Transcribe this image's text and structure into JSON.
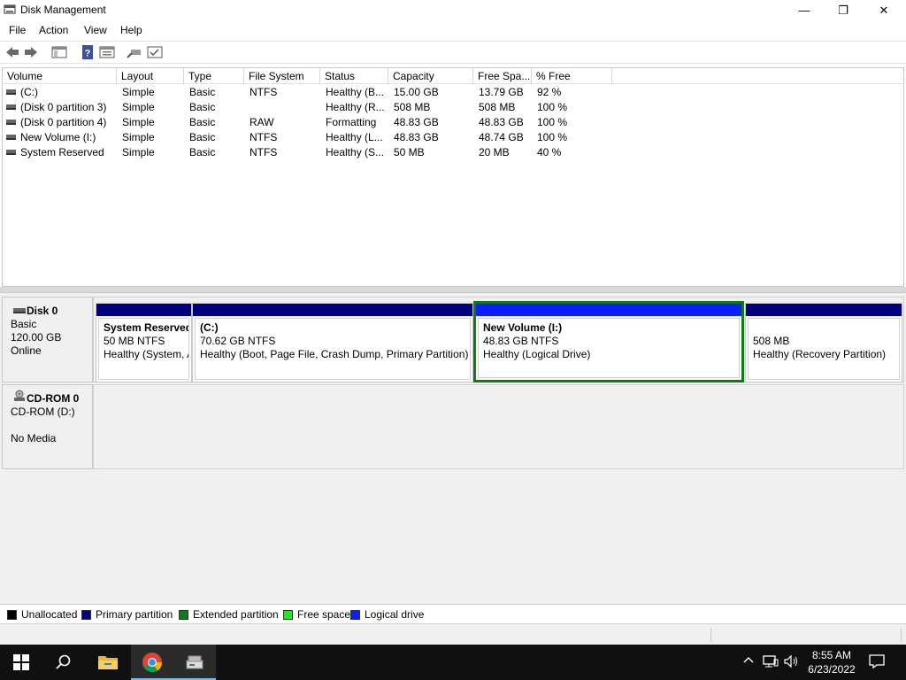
{
  "window": {
    "title": "Disk Management",
    "icon": "disk-management-icon",
    "controls": {
      "minimize": "—",
      "restore": "❐",
      "close": "✕"
    }
  },
  "menu": [
    "File",
    "Action",
    "View",
    "Help"
  ],
  "toolbar": [
    "back-arrow-icon",
    "forward-arrow-icon",
    "show-hide-console-tree-icon",
    "help-icon",
    "properties-icon",
    "connect-icon",
    "export-list-icon"
  ],
  "volume_list": {
    "columns": [
      "Volume",
      "Layout",
      "Type",
      "File System",
      "Status",
      "Capacity",
      "Free Spa...",
      "% Free"
    ],
    "rows": [
      [
        "(C:)",
        "Simple",
        "Basic",
        "NTFS",
        "Healthy (B...",
        "15.00 GB",
        "13.79 GB",
        "92 %"
      ],
      [
        "(Disk 0 partition 3)",
        "Simple",
        "Basic",
        "",
        "Healthy (R...",
        "508 MB",
        "508 MB",
        "100 %"
      ],
      [
        "(Disk 0 partition 4)",
        "Simple",
        "Basic",
        "RAW",
        "Formatting",
        "48.83 GB",
        "48.83 GB",
        "100 %"
      ],
      [
        "New Volume (I:)",
        "Simple",
        "Basic",
        "NTFS",
        "Healthy (L...",
        "48.83 GB",
        "48.74 GB",
        "100 %"
      ],
      [
        "System Reserved",
        "Simple",
        "Basic",
        "NTFS",
        "Healthy (S...",
        "50 MB",
        "20 MB",
        "40 %"
      ]
    ]
  },
  "disks": [
    {
      "name": "Disk 0",
      "lines": [
        "Basic",
        "120.00 GB",
        "Online"
      ],
      "partitions": [
        {
          "name": "System Reserved",
          "size": "50 MB NTFS",
          "status": "Healthy (System, A"
        },
        {
          "name": "(C:)",
          "size": "70.62 GB NTFS",
          "status": "Healthy (Boot, Page File, Crash Dump, Primary Partition)"
        },
        {
          "name": "New Volume  (I:)",
          "size": "48.83 GB NTFS",
          "status": "Healthy (Logical Drive)"
        },
        {
          "name": "",
          "size": "508 MB",
          "status": "Healthy (Recovery Partition)"
        }
      ]
    },
    {
      "name": "CD-ROM 0",
      "lines": [
        "CD-ROM (D:)",
        "",
        "No Media"
      ]
    }
  ],
  "legend": [
    {
      "label": "Unallocated",
      "color": "#000000"
    },
    {
      "label": "Primary partition",
      "color": "#00007f"
    },
    {
      "label": "Extended partition",
      "color": "#117a18"
    },
    {
      "label": "Free space",
      "color": "#22e622"
    },
    {
      "label": "Logical drive",
      "color": "#0a1eff"
    }
  ],
  "colors": {
    "primary": "#00007f",
    "logical": "#0a1eff",
    "selection": "#117a18"
  },
  "taskbar": {
    "apps": [
      "start-icon",
      "search-icon",
      "file-explorer-icon",
      "chrome-icon",
      "disk-management-icon"
    ],
    "clock": {
      "time": "8:55 AM",
      "date": "6/23/2022"
    }
  }
}
